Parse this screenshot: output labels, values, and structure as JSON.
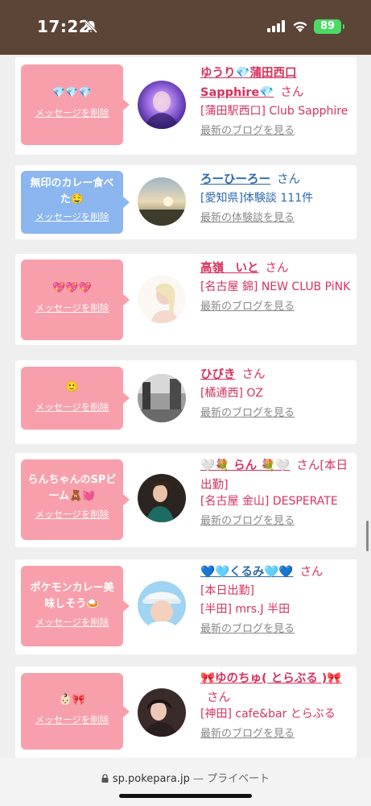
{
  "status": {
    "time": "17:22",
    "battery": "89"
  },
  "browser": {
    "url": "sp.pokepara.jp",
    "separator": " — ",
    "mode": "プライベート"
  },
  "items": [
    {
      "message": "💎💎💎",
      "delete_label": "メッセージを削除",
      "name": "ゆうり💎蒲田西口Sapphire💎",
      "san": "さん",
      "line1": "[蒲田駅西口] Club Sapphire",
      "line2": "",
      "link": "最新のブログを見る",
      "bubble_color": "pink"
    },
    {
      "message": "無印のカレー食べた🤤",
      "delete_label": "メッセージを削除",
      "name": "ろーひーろー",
      "san": "さん",
      "line1": "[愛知県]体験談 111件",
      "line2": "",
      "link": "最新の体験談を見る",
      "bubble_color": "blue"
    },
    {
      "message": "💖💖💖",
      "delete_label": "メッセージを削除",
      "name": "高嶺　いと",
      "san": "さん",
      "line1": "[名古屋 錦] NEW CLUB PiNK",
      "line2": "",
      "link": "最新のブログを見る",
      "bubble_color": "pink"
    },
    {
      "message": "🙂",
      "delete_label": "メッセージを削除",
      "name": "ひびき",
      "san": "さん",
      "line1": "[橘通西] OZ",
      "line2": "",
      "link": "最新のブログを見る",
      "bubble_color": "pink"
    },
    {
      "message": "らんちゃんのSPビーム🧸💓",
      "delete_label": "メッセージを削除",
      "name": "🤍💐 らん 💐🤍",
      "san": "さん[本日出勤]",
      "line1": "[名古屋 金山] DESPERATE",
      "line2": "",
      "link": "最新のブログを見る",
      "bubble_color": "pink"
    },
    {
      "message": "ポケモンカレー美味しそう🍛",
      "delete_label": "メッセージを削除",
      "name": "💙🩵くるみ🩵💙",
      "san": "さん",
      "line1": "[本日出勤]",
      "line2": "[半田] mrs.J 半田",
      "link": "最新のブログを見る",
      "bubble_color": "pink"
    },
    {
      "message": "👶🏻🎀",
      "delete_label": "メッセージを削除",
      "name": "🎀ゆのちゅ( とらぶる )🎀",
      "san": "さん",
      "line1": "[神田] cafe&bar とらぶる",
      "line2": "",
      "link": "最新のブログを見る",
      "bubble_color": "pink"
    }
  ],
  "colors": {
    "header": "#5a4536",
    "pink": "#f7a0ab",
    "blue": "#8bb6ef",
    "name_pink": "#d6325f",
    "name_blue": "#2c6aa8"
  }
}
